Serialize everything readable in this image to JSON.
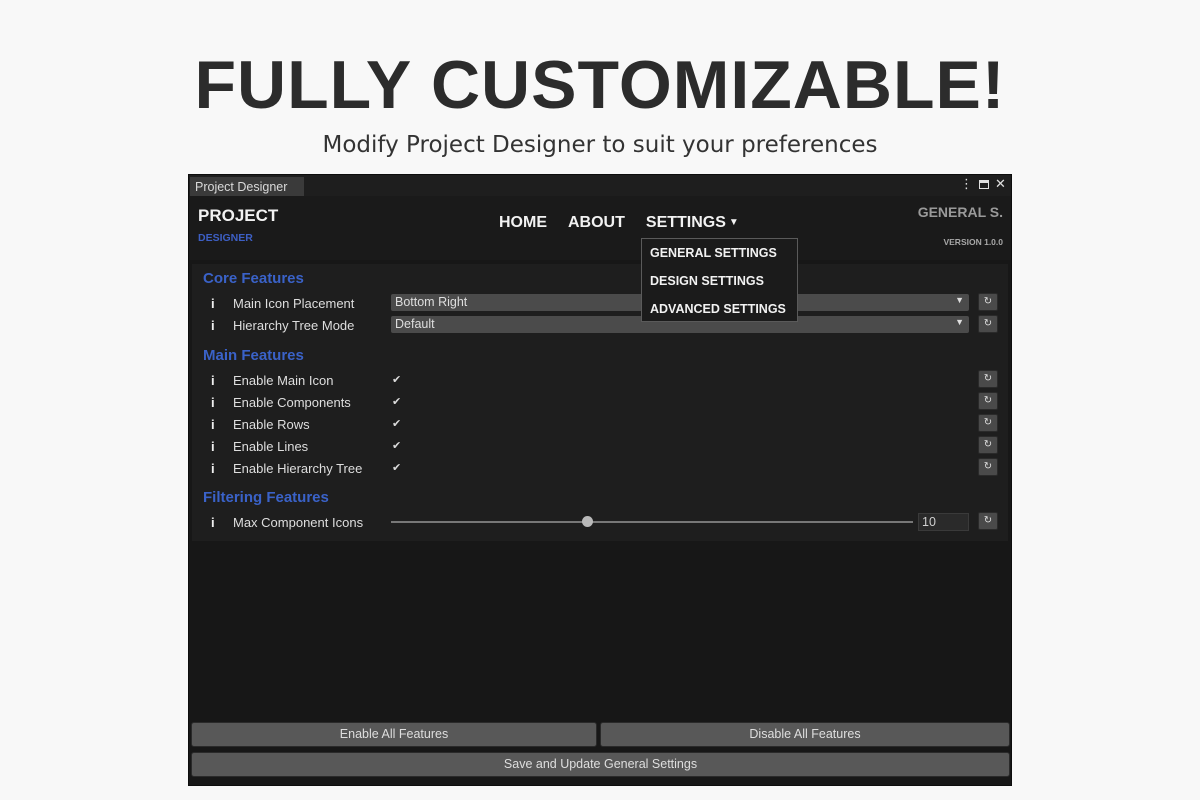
{
  "promo": {
    "title": "FULLY CUSTOMIZABLE!",
    "subtitle": "Modify Project Designer to suit your preferences"
  },
  "window": {
    "tab_title": "Project Designer",
    "controls": {
      "menu": "⋮",
      "close": "✕"
    }
  },
  "header": {
    "logo_main": "PROJECT",
    "logo_sub": "DESIGNER",
    "nav": [
      "HOME",
      "ABOUT",
      "SETTINGS"
    ],
    "settings_caret": "▼",
    "brand": "GENERAL S.",
    "version": "VERSION 1.0.0"
  },
  "dropdown": {
    "items": [
      "GENERAL SETTINGS",
      "DESIGN SETTINGS",
      "ADVANCED SETTINGS"
    ]
  },
  "sections": {
    "core": {
      "title": "Core Features",
      "rows": [
        {
          "label": "Main Icon Placement",
          "value": "Bottom Right"
        },
        {
          "label": "Hierarchy Tree Mode",
          "value": "Default"
        }
      ]
    },
    "main": {
      "title": "Main Features",
      "rows": [
        {
          "label": "Enable Main Icon",
          "checked": true
        },
        {
          "label": "Enable Components",
          "checked": true
        },
        {
          "label": "Enable Rows",
          "checked": true
        },
        {
          "label": "Enable Lines",
          "checked": true
        },
        {
          "label": "Enable Hierarchy Tree",
          "checked": true
        }
      ]
    },
    "filtering": {
      "title": "Filtering Features",
      "rows": [
        {
          "label": "Max Component Icons",
          "value": "10",
          "slider_fraction": 0.375
        }
      ]
    }
  },
  "icons": {
    "info": "i",
    "reset": "↻",
    "check": "✔",
    "select_caret": "▼"
  },
  "footer": {
    "enable_all": "Enable All Features",
    "disable_all": "Disable All Features",
    "save": "Save and Update General Settings"
  },
  "colors": {
    "accent": "#3a62c8",
    "window_bg": "#171717",
    "button_bg": "#585858"
  }
}
